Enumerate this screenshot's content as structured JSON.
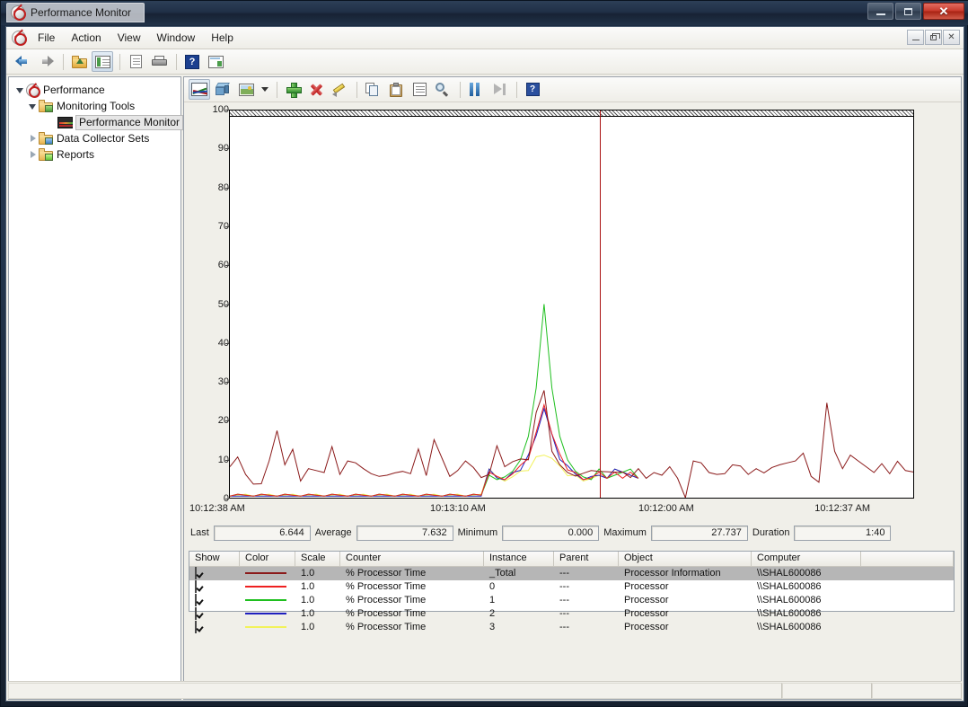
{
  "window": {
    "title": "Performance Monitor",
    "logo_icon": "perfmon-icon",
    "minimize_label": "Minimize",
    "maximize_label": "Maximize",
    "close_label": "Close"
  },
  "menubar": {
    "icon": "perfmon-icon",
    "items": [
      "File",
      "Action",
      "View",
      "Window",
      "Help"
    ],
    "mdi": {
      "minimize": "Minimize",
      "restore": "Restore",
      "close": "Close"
    }
  },
  "main_toolbar": {
    "buttons": [
      {
        "name": "back-button",
        "icon": "back-arrow-icon"
      },
      {
        "name": "forward-button",
        "icon": "forward-arrow-icon"
      },
      {
        "name": "up-one-level-button",
        "icon": "folder-up-icon"
      },
      {
        "name": "show-hide-console-tree-button",
        "icon": "console-tree-icon"
      },
      {
        "name": "properties-button",
        "icon": "properties-document-icon"
      },
      {
        "name": "export-list-button",
        "icon": "export-printer-icon"
      },
      {
        "name": "help-button",
        "icon": "help-icon"
      },
      {
        "name": "new-window-button",
        "icon": "new-window-icon"
      }
    ]
  },
  "graph_toolbar": {
    "buttons": [
      {
        "name": "view-current-activity-button",
        "icon": "line-chart-icon"
      },
      {
        "name": "view-log-data-button",
        "icon": "cube-icon"
      },
      {
        "name": "change-graph-type-button",
        "icon": "graph-type-icon"
      },
      {
        "name": "graph-type-dropdown",
        "icon": "chevron-down-icon"
      },
      {
        "name": "add-counters-button",
        "icon": "plus-icon"
      },
      {
        "name": "delete-counter-button",
        "icon": "red-x-icon"
      },
      {
        "name": "highlight-button",
        "icon": "pencil-icon"
      },
      {
        "name": "copy-properties-button",
        "icon": "copy-icon"
      },
      {
        "name": "paste-counter-list-button",
        "icon": "clipboard-icon"
      },
      {
        "name": "properties-button",
        "icon": "properties-icon"
      },
      {
        "name": "zoom-button",
        "icon": "magnifier-icon"
      },
      {
        "name": "freeze-display-button",
        "icon": "pause-icon"
      },
      {
        "name": "update-data-button",
        "icon": "step-forward-icon"
      },
      {
        "name": "help-button",
        "icon": "help-question-icon"
      }
    ]
  },
  "tree": {
    "items": [
      {
        "label": "Performance",
        "icon": "perfmon-icon",
        "indent": 1,
        "twisty": "expanded",
        "selected": false
      },
      {
        "label": "Monitoring Tools",
        "icon": "folder-green-icon",
        "indent": 2,
        "twisty": "expanded",
        "selected": false
      },
      {
        "label": "Performance Monitor",
        "icon": "monitor-icon",
        "indent": 3,
        "twisty": "none",
        "selected": true
      },
      {
        "label": "Data Collector Sets",
        "icon": "folder-blue-icon",
        "indent": 2,
        "twisty": "collapsed",
        "selected": false
      },
      {
        "label": "Reports",
        "icon": "folder-lime-icon",
        "indent": 2,
        "twisty": "collapsed",
        "selected": false
      }
    ]
  },
  "chart_data": {
    "type": "line",
    "title": "",
    "xlabel": "",
    "ylabel": "",
    "ylim": [
      0,
      100
    ],
    "y_ticks": [
      0,
      10,
      20,
      30,
      40,
      50,
      60,
      70,
      80,
      90,
      100
    ],
    "grid": false,
    "legend_position": "bottom-table",
    "x_tick_labels": [
      "10:12:38 AM",
      "10:13:10 AM",
      "10:12:00 AM",
      "10:12:37 AM"
    ],
    "cursor_position_pct": 54.1,
    "ceiling_band": "hatched 100% band",
    "series": [
      {
        "name": "% Processor Time (_Total, Processor Information)",
        "color": "#8b1a1a",
        "values": [
          8.0,
          10.5,
          6.0,
          3.5,
          3.6,
          9.5,
          17.3,
          8.5,
          12.5,
          4.3,
          7.5,
          7.0,
          6.5,
          13.2,
          6.0,
          9.5,
          9.0,
          7.5,
          6.2,
          5.5,
          5.8,
          6.4,
          6.8,
          6.2,
          12.6,
          5.7,
          15.0,
          10.2,
          5.5,
          7.0,
          9.5,
          7.8,
          5.2,
          6.0,
          13.4,
          8.0,
          9.3,
          10.0,
          9.8,
          22.0,
          27.7,
          12.0,
          8.5,
          6.5,
          5.6,
          6.3,
          7.0,
          6.8,
          6.7,
          6.6,
          6.644,
          5.2,
          7.5,
          5.0,
          6.5,
          5.8,
          8.0,
          5.0,
          0.0,
          9.5,
          9.0,
          6.5,
          6.0,
          6.2,
          8.5,
          8.2,
          6.0,
          7.5,
          6.4,
          7.8,
          8.5,
          9.0,
          9.5,
          11.5,
          5.5,
          4.0,
          24.5,
          12.0,
          7.5,
          11.0,
          9.5,
          8.0,
          6.5,
          8.8,
          6.2,
          9.4,
          7.0,
          6.644
        ]
      },
      {
        "name": "% Processor Time (0, Processor)",
        "color": "#ee2020",
        "values": []
      },
      {
        "name": "% Processor Time (1, Processor)",
        "color": "#1fbf1f",
        "values": [],
        "peak": 50.0
      },
      {
        "name": "% Processor Time (2, Processor)",
        "color": "#1f1fbf",
        "values": [],
        "peak": 23.0
      },
      {
        "name": "% Processor Time (3, Processor)",
        "color": "#f2f25a",
        "values": [],
        "peak": 11.0
      }
    ]
  },
  "stats": {
    "fields": [
      {
        "label": "Last",
        "value": "6.644"
      },
      {
        "label": "Average",
        "value": "7.632"
      },
      {
        "label": "Minimum",
        "value": "0.000"
      },
      {
        "label": "Maximum",
        "value": "27.737"
      },
      {
        "label": "Duration",
        "value": "1:40"
      }
    ]
  },
  "counter_table": {
    "headers": [
      "Show",
      "Color",
      "Scale",
      "Counter",
      "Instance",
      "Parent",
      "Object",
      "Computer"
    ],
    "rows": [
      {
        "show": true,
        "color": "#8b1a1a",
        "scale": "1.0",
        "counter": "% Processor Time",
        "instance": "_Total",
        "parent": "---",
        "object": "Processor Information",
        "computer": "\\\\SHAL600086",
        "selected": true
      },
      {
        "show": true,
        "color": "#ee2020",
        "scale": "1.0",
        "counter": "% Processor Time",
        "instance": "0",
        "parent": "---",
        "object": "Processor",
        "computer": "\\\\SHAL600086",
        "selected": false
      },
      {
        "show": true,
        "color": "#1fbf1f",
        "scale": "1.0",
        "counter": "% Processor Time",
        "instance": "1",
        "parent": "---",
        "object": "Processor",
        "computer": "\\\\SHAL600086",
        "selected": false
      },
      {
        "show": true,
        "color": "#1f1fbf",
        "scale": "1.0",
        "counter": "% Processor Time",
        "instance": "2",
        "parent": "---",
        "object": "Processor",
        "computer": "\\\\SHAL600086",
        "selected": false
      },
      {
        "show": true,
        "color": "#f2f25a",
        "scale": "1.0",
        "counter": "% Processor Time",
        "instance": "3",
        "parent": "---",
        "object": "Processor",
        "computer": "\\\\SHAL600086",
        "selected": false
      }
    ]
  },
  "statusbar": {
    "main": "",
    "pane2": "",
    "pane3": ""
  }
}
